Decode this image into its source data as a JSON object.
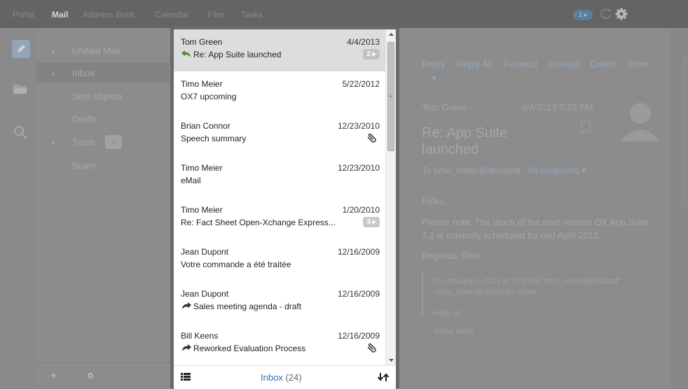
{
  "topbar": {
    "apps": [
      {
        "label": "Portal",
        "active": false
      },
      {
        "label": "Mail",
        "active": true
      },
      {
        "label": "Address Book",
        "active": false
      },
      {
        "label": "Calendar",
        "active": false
      },
      {
        "label": "Files",
        "active": false
      },
      {
        "label": "Tasks",
        "active": false
      }
    ],
    "notification_badge": "1 ▸",
    "refresh_icon": "refresh-icon",
    "settings_icon": "gear-icon"
  },
  "rail": {
    "icons": [
      "compose-icon",
      "folder-icon",
      "search-icon"
    ]
  },
  "folders": [
    {
      "label": "Unified Mail",
      "expandable": true
    },
    {
      "label": "Inbox",
      "expandable": true,
      "selected": true
    },
    {
      "label": "Sent objects",
      "expandable": false
    },
    {
      "label": "Drafts",
      "expandable": false
    },
    {
      "label": "Trash",
      "expandable": true,
      "count": "2"
    },
    {
      "label": "Spam",
      "expandable": false
    }
  ],
  "tree_bottom": {
    "add_label": "+",
    "settings_icon": "gear-icon"
  },
  "mail_list": {
    "items": [
      {
        "sender": "Tom Green",
        "date": "4/4/2013",
        "subject": "Re: App Suite launched",
        "icon": "reply-icon",
        "thread": "2 ▸",
        "selected": true
      },
      {
        "sender": "Timo Meier",
        "date": "5/22/2012",
        "subject": "OX7 upcoming"
      },
      {
        "sender": "Brian Connor",
        "date": "12/23/2010",
        "subject": "Speech summary",
        "attachment": true
      },
      {
        "sender": "Timo Meier",
        "date": "12/23/2010",
        "subject": "eMail"
      },
      {
        "sender": "Timo Meier",
        "date": "1/20/2010",
        "subject": "Re: Fact Sheet Open-Xchange Express...",
        "thread": "3 ▸"
      },
      {
        "sender": "Jean Dupont",
        "date": "12/16/2009",
        "subject": "Votre commande a été traitée"
      },
      {
        "sender": "Jean Dupont",
        "date": "12/16/2009",
        "subject": "Sales meeting agenda - draft",
        "icon": "forward-icon"
      },
      {
        "sender": "Bill Keens",
        "date": "12/16/2009",
        "subject": "Reworked Evaluation Process",
        "icon": "forward-icon",
        "attachment": true
      }
    ],
    "footer": {
      "folder": "Inbox",
      "count": "(24)"
    }
  },
  "detail": {
    "actions": [
      "Reply",
      "Reply All",
      "Forward",
      "Unread",
      "Delete",
      "More ... ▾"
    ],
    "from": "Tom Green",
    "date": "4/4/2013 5:23 PM",
    "subject": "Re: App Suite launched",
    "to_label": "To",
    "to_address": "timo_meier@docboat",
    "all_recipients": "All recipients ▾",
    "greeting": "Folks,",
    "body": "Please note: The lauch of the next version OX App Suite 7.2 is currently scheduled for mid April 2013.",
    "signoff": "Regards, Timo",
    "quote": "On January 2, 2013 at 8:08 AM \"timo_meier@docboat\" <timo_meier@docboat> wrote:",
    "quote_more": "Hello all",
    "show_more": "Show more"
  },
  "colors": {
    "accent": "#2f6fb1",
    "overlay": "#8c8c8c",
    "list_bg": "#ffffff",
    "selected_row": "#dddddd"
  }
}
